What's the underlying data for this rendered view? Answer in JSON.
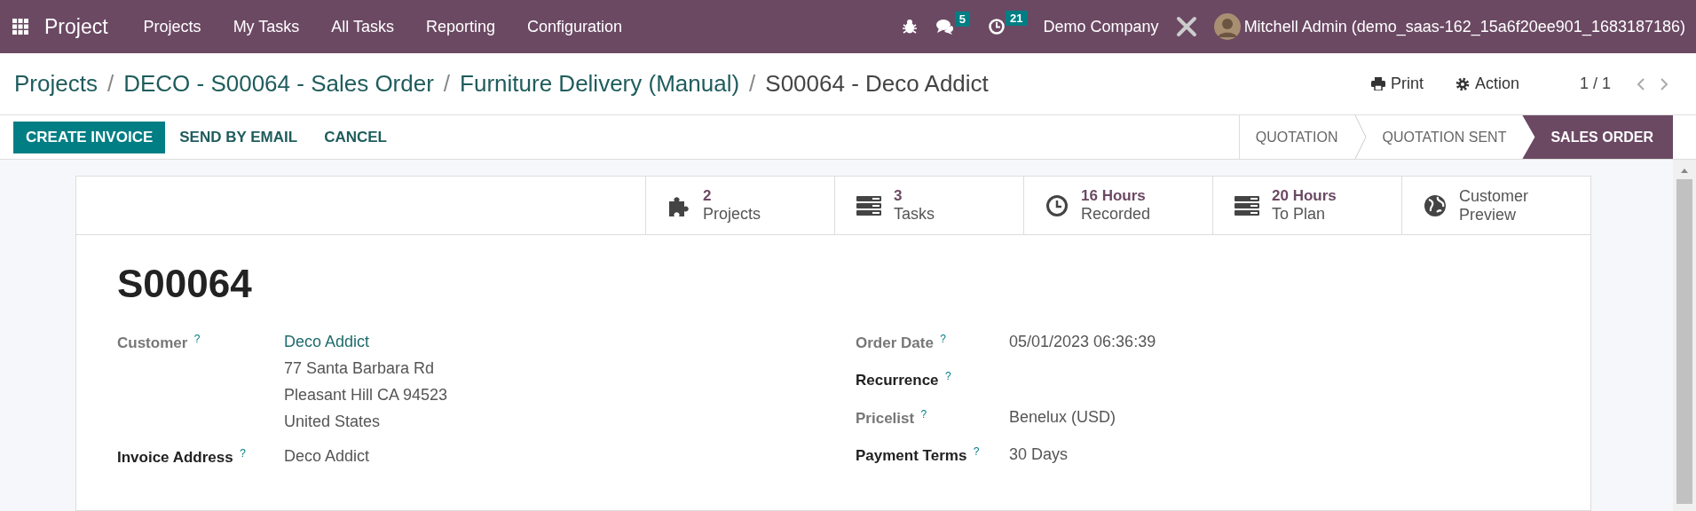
{
  "navbar": {
    "app_name": "Project",
    "menu": [
      "Projects",
      "My Tasks",
      "All Tasks",
      "Reporting",
      "Configuration"
    ],
    "messages_count": "5",
    "activities_count": "21",
    "company": "Demo Company",
    "user": "Mitchell Admin (demo_saas-162_15a6f20ee901_1683187186)"
  },
  "breadcrumbs": [
    "Projects",
    "DECO - S00064 - Sales Order",
    "Furniture Delivery (Manual)",
    "S00064 - Deco Addict"
  ],
  "breadcrumb_separator": "/",
  "help_mark": "?",
  "actions": {
    "print": "Print",
    "action": "Action",
    "pager": "1 / 1"
  },
  "buttons": [
    {
      "label": "CREATE INVOICE",
      "primary": true
    },
    {
      "label": "SEND BY EMAIL",
      "primary": false
    },
    {
      "label": "CANCEL",
      "primary": false
    }
  ],
  "stages": [
    {
      "label": "QUOTATION",
      "selected": false
    },
    {
      "label": "QUOTATION SENT",
      "selected": false
    },
    {
      "label": "SALES ORDER",
      "selected": true
    }
  ],
  "stat_buttons": [
    {
      "kind": "puzzle",
      "value": "2",
      "label": "Projects"
    },
    {
      "kind": "tasks",
      "value": "3",
      "label": "Tasks"
    },
    {
      "kind": "clock",
      "value": "16 Hours",
      "label": "Recorded"
    },
    {
      "kind": "tasks",
      "value": "20 Hours",
      "label": "To Plan"
    },
    {
      "kind": "globe",
      "lines": [
        "Customer",
        "Preview"
      ]
    }
  ],
  "title": "S00064",
  "left_fields": [
    {
      "label": "Customer",
      "strong": false,
      "link": "Deco Addict",
      "lines": [
        "77 Santa Barbara Rd",
        "Pleasant Hill CA 94523",
        "United States"
      ]
    },
    {
      "label": "Invoice Address",
      "strong": true,
      "lines": [
        "Deco Addict"
      ]
    }
  ],
  "right_fields": [
    {
      "label": "Order Date",
      "strong": false,
      "lines": [
        "05/01/2023 06:36:39"
      ]
    },
    {
      "label": "Recurrence",
      "strong": true
    },
    {
      "label": "Pricelist",
      "strong": false,
      "lines": [
        "Benelux (USD)"
      ]
    },
    {
      "label": "Payment Terms",
      "strong": true,
      "lines": [
        "30 Days"
      ]
    }
  ]
}
